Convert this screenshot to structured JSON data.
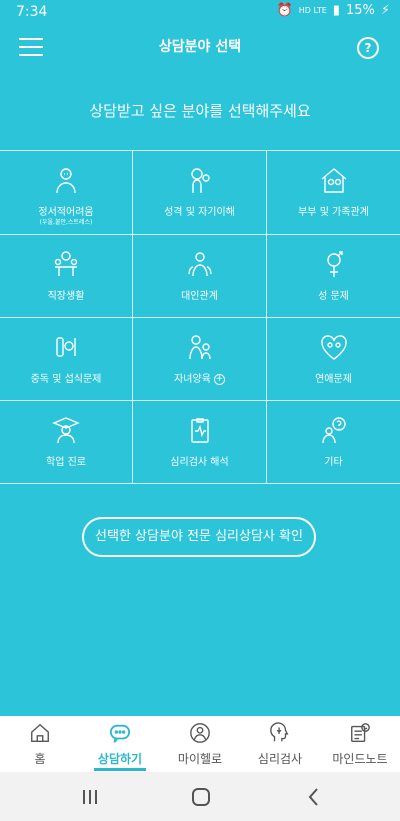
{
  "status": {
    "time": "7:34",
    "net_top": "HD LTE",
    "battery": "15%"
  },
  "header": {
    "title": "상담분야 선택",
    "help": "?"
  },
  "subtitle": "상담받고 싶은 분야를 선택해주세요",
  "categories": [
    {
      "label": "정서적어려움",
      "sub": "(우울,불안,스트레스)",
      "icon": "emotion-icon"
    },
    {
      "label": "성격 및 자기이해",
      "icon": "personality-icon"
    },
    {
      "label": "부부 및 가족관계",
      "icon": "family-house-icon"
    },
    {
      "label": "직장생활",
      "icon": "workplace-icon"
    },
    {
      "label": "대인관계",
      "icon": "relationship-icon"
    },
    {
      "label": "성 문제",
      "icon": "gender-symbol-icon"
    },
    {
      "label": "중독 및 섭식문제",
      "icon": "addiction-icon"
    },
    {
      "label": "자녀양육",
      "icon": "parenting-icon",
      "has_plus": true
    },
    {
      "label": "연애문제",
      "icon": "love-heart-icon"
    },
    {
      "label": "학업 진로",
      "icon": "graduate-icon"
    },
    {
      "label": "심리검사 해석",
      "icon": "clipboard-icon"
    },
    {
      "label": "기타",
      "icon": "question-person-icon"
    }
  ],
  "confirm_button": "선택한 상담분야 전문 심리상담사 확인",
  "nav": [
    {
      "label": "홈",
      "icon": "home-icon"
    },
    {
      "label": "상담하기",
      "icon": "chat-icon",
      "active": true
    },
    {
      "label": "마이헬로",
      "icon": "profile-icon"
    },
    {
      "label": "심리검사",
      "icon": "brain-head-icon"
    },
    {
      "label": "마인드노트",
      "icon": "note-icon"
    }
  ],
  "colors": {
    "accent": "#2bc4d8",
    "active": "#2bb8cc"
  }
}
